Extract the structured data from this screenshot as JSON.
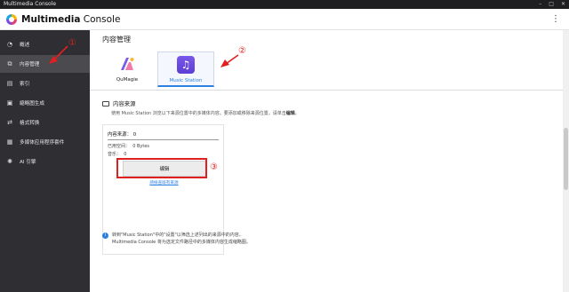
{
  "window": {
    "title": "Multimedia Console",
    "controls": [
      "–",
      "□",
      "✕"
    ]
  },
  "appbar": {
    "brand_bold": "Multimedia",
    "brand_rest": " Console",
    "menu_icon": "kebab-icon"
  },
  "sidebar": {
    "items": [
      {
        "label": "概述",
        "icon": "dashboard-icon",
        "glyph": "◔",
        "active": false
      },
      {
        "label": "内容管理",
        "icon": "content-manage-icon",
        "glyph": "⧉",
        "active": true
      },
      {
        "label": "索引",
        "icon": "index-icon",
        "glyph": "▤",
        "active": false
      },
      {
        "label": "縮略图生成",
        "icon": "thumbnail-icon",
        "glyph": "▣",
        "active": false
      },
      {
        "label": "格式转换",
        "icon": "transcode-icon",
        "glyph": "⇄",
        "active": false
      },
      {
        "label": "多媒体应用程序套件",
        "icon": "app-suite-icon",
        "glyph": "▦",
        "active": false
      },
      {
        "label": "AI 引擎",
        "icon": "ai-engine-icon",
        "glyph": "✺",
        "active": false
      }
    ]
  },
  "main": {
    "title": "内容管理",
    "tabs": [
      {
        "label": "QuMagie",
        "active": false
      },
      {
        "label": "Music Station",
        "active": true,
        "glyph": "♫"
      }
    ],
    "section": {
      "title": "内容来源",
      "desc_prefix": "使用 Music Station 浏览以下来源位置中的多媒体内容。要添加或移除来源位置，请单击",
      "desc_bold": "编辑",
      "desc_suffix": "。"
    },
    "card": {
      "head_label": "内容来源：",
      "head_value": "0",
      "used_label": "已用空间：",
      "used_value": "0 Bytes",
      "music_label": "音乐：",
      "music_value": "0",
      "edit_button": "编辑",
      "link": "請檢查既有來源"
    },
    "note": {
      "line1": "转到\"Music Station\"中的\"设置\"以筛选上述列出的来源中的内容。",
      "line2": "Multimedia Console 将为选定文件路径中的多媒体内容生成缩略图。"
    }
  },
  "annotations": {
    "one": "①",
    "two": "②",
    "three": "③"
  },
  "colors": {
    "accent": "#2d7fe0",
    "annotation": "#e02020",
    "sidebar_bg": "#2f2f33"
  }
}
